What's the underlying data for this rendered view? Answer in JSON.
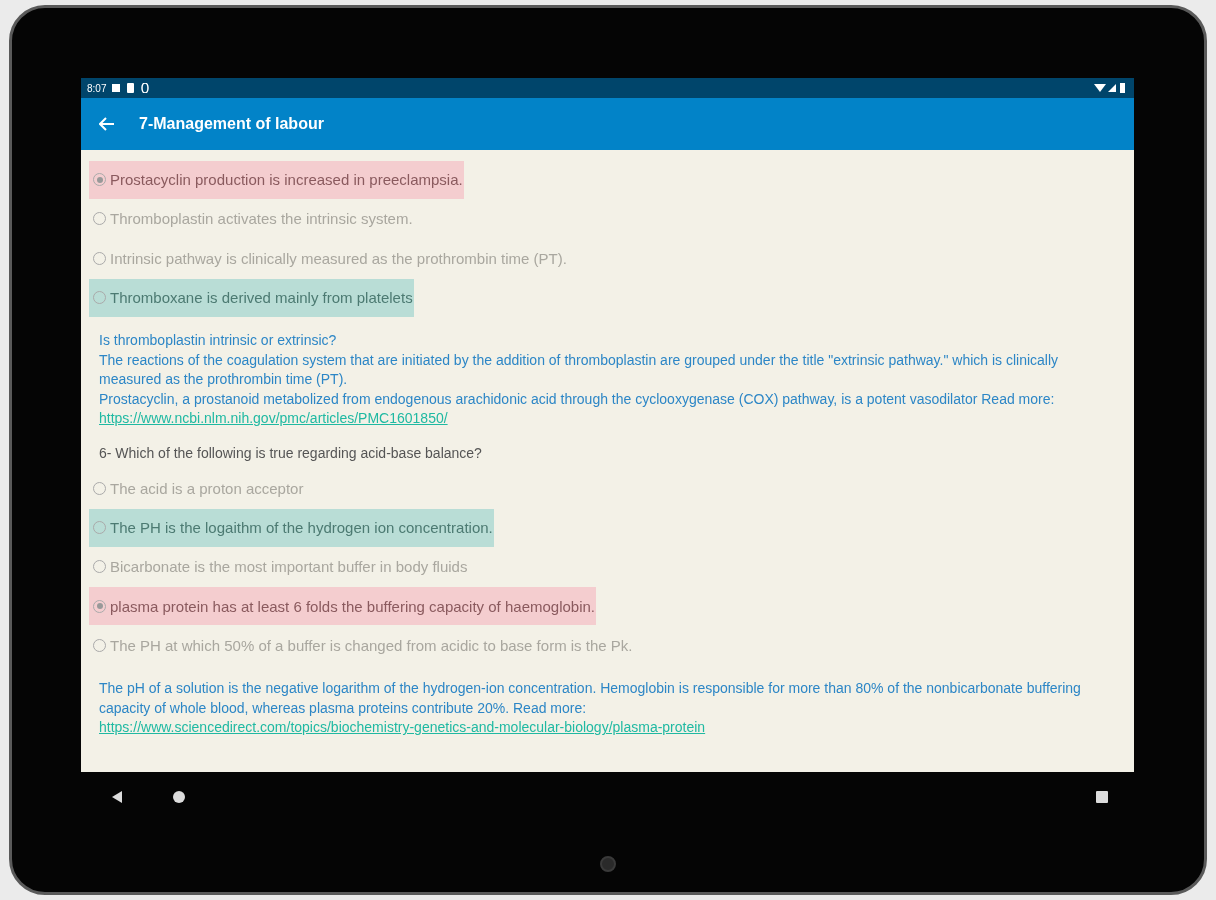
{
  "status_bar": {
    "time": "8:07"
  },
  "app_bar": {
    "title": "7-Management of labour"
  },
  "question_blocks": [
    {
      "options": [
        {
          "text": "Prostacyclin production is increased in preeclampsia.",
          "selected": true,
          "kind": "incorrect"
        },
        {
          "text": "Thromboplastin activates the intrinsic system.",
          "selected": false,
          "kind": "plain"
        },
        {
          "text": "Intrinsic pathway is clinically measured as the prothrombin time (PT).",
          "selected": false,
          "kind": "plain"
        },
        {
          "text": "Thromboxane is derived mainly from platelets",
          "selected": false,
          "kind": "correct"
        }
      ],
      "explanation": [
        "Is thromboplastin intrinsic or extrinsic?",
        "The reactions of the coagulation system that are initiated by the addition of thromboplastin are grouped under the title \"extrinsic pathway.\" which is clinically measured as the prothrombin time (PT).",
        "Prostacyclin, a prostanoid metabolized from endogenous arachidonic acid through the cyclooxygenase (COX) pathway, is a potent vasodilator Read more:"
      ],
      "link": "https://www.ncbi.nlm.nih.gov/pmc/articles/PMC1601850/"
    },
    {
      "question": "6- Which of the following is true regarding acid-base balance?",
      "options": [
        {
          "text": "The acid is a proton acceptor",
          "selected": false,
          "kind": "plain"
        },
        {
          "text": "The PH is the logaithm of the hydrogen ion concentration.",
          "selected": false,
          "kind": "correct"
        },
        {
          "text": "Bicarbonate is the most important buffer in body fluids",
          "selected": false,
          "kind": "plain"
        },
        {
          "text": "plasma protein has at least 6 folds the buffering capacity of haemoglobin.",
          "selected": true,
          "kind": "incorrect"
        },
        {
          "text": "The PH at which 50% of a buffer is changed from acidic to base form is the Pk.",
          "selected": false,
          "kind": "plain"
        }
      ],
      "explanation": [
        "The pH of a solution is the negative logarithm of the hydrogen-ion concentration. Hemoglobin is responsible for more than 80% of the nonbicarbonate buffering capacity of whole blood, whereas plasma proteins contribute 20%. Read more:"
      ],
      "link": "https://www.sciencedirect.com/topics/biochemistry-genetics-and-molecular-biology/plasma-protein"
    }
  ]
}
